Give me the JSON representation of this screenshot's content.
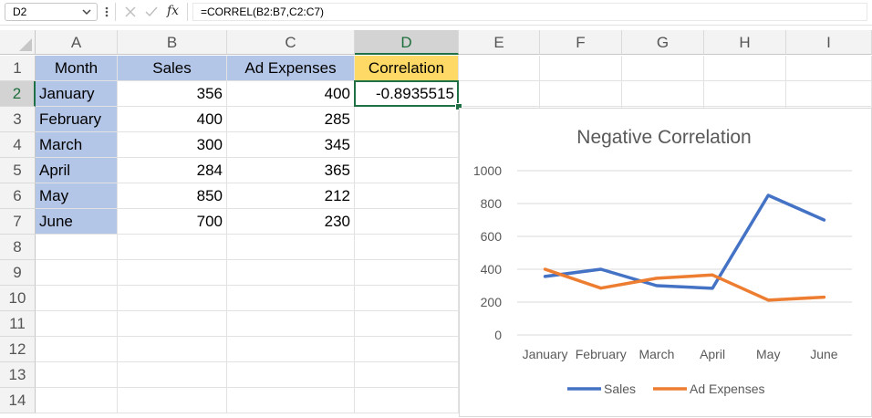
{
  "formula_bar": {
    "name_box": "D2",
    "fx_label": "fx",
    "formula": "=CORREL(B2:B7,C2:C7)"
  },
  "columns": [
    "A",
    "B",
    "C",
    "D",
    "E",
    "F",
    "G",
    "H",
    "I"
  ],
  "selected_column": "D",
  "rows": [
    "1",
    "2",
    "3",
    "4",
    "5",
    "6",
    "7",
    "8",
    "9",
    "10",
    "11",
    "12",
    "13",
    "14"
  ],
  "selected_row": "2",
  "header_row": {
    "month": "Month",
    "sales": "Sales",
    "ad": "Ad Expenses",
    "corr": "Correlation"
  },
  "correlation_value": "-0.8935515",
  "table_rows": [
    {
      "month": "January",
      "sales": "356",
      "ad": "400"
    },
    {
      "month": "February",
      "sales": "400",
      "ad": "285"
    },
    {
      "month": "March",
      "sales": "300",
      "ad": "345"
    },
    {
      "month": "April",
      "sales": "284",
      "ad": "365"
    },
    {
      "month": "May",
      "sales": "850",
      "ad": "212"
    },
    {
      "month": "June",
      "sales": "700",
      "ad": "230"
    }
  ],
  "colors": {
    "header_fill": "#b4c6e7",
    "correlation_fill": "#ffd966",
    "selection": "#1f7145"
  },
  "chart_data": {
    "type": "line",
    "title": "Negative Correlation",
    "categories": [
      "January",
      "February",
      "March",
      "April",
      "May",
      "June"
    ],
    "series": [
      {
        "name": "Sales",
        "values": [
          356,
          400,
          300,
          284,
          850,
          700
        ],
        "color": "#4472c4"
      },
      {
        "name": "Ad Expenses",
        "values": [
          400,
          285,
          345,
          365,
          212,
          230
        ],
        "color": "#ed7d31"
      }
    ],
    "ylim": [
      0,
      1000
    ],
    "yticks": [
      "0",
      "200",
      "400",
      "600",
      "800",
      "1000"
    ],
    "grid": true,
    "legend": "bottom"
  }
}
